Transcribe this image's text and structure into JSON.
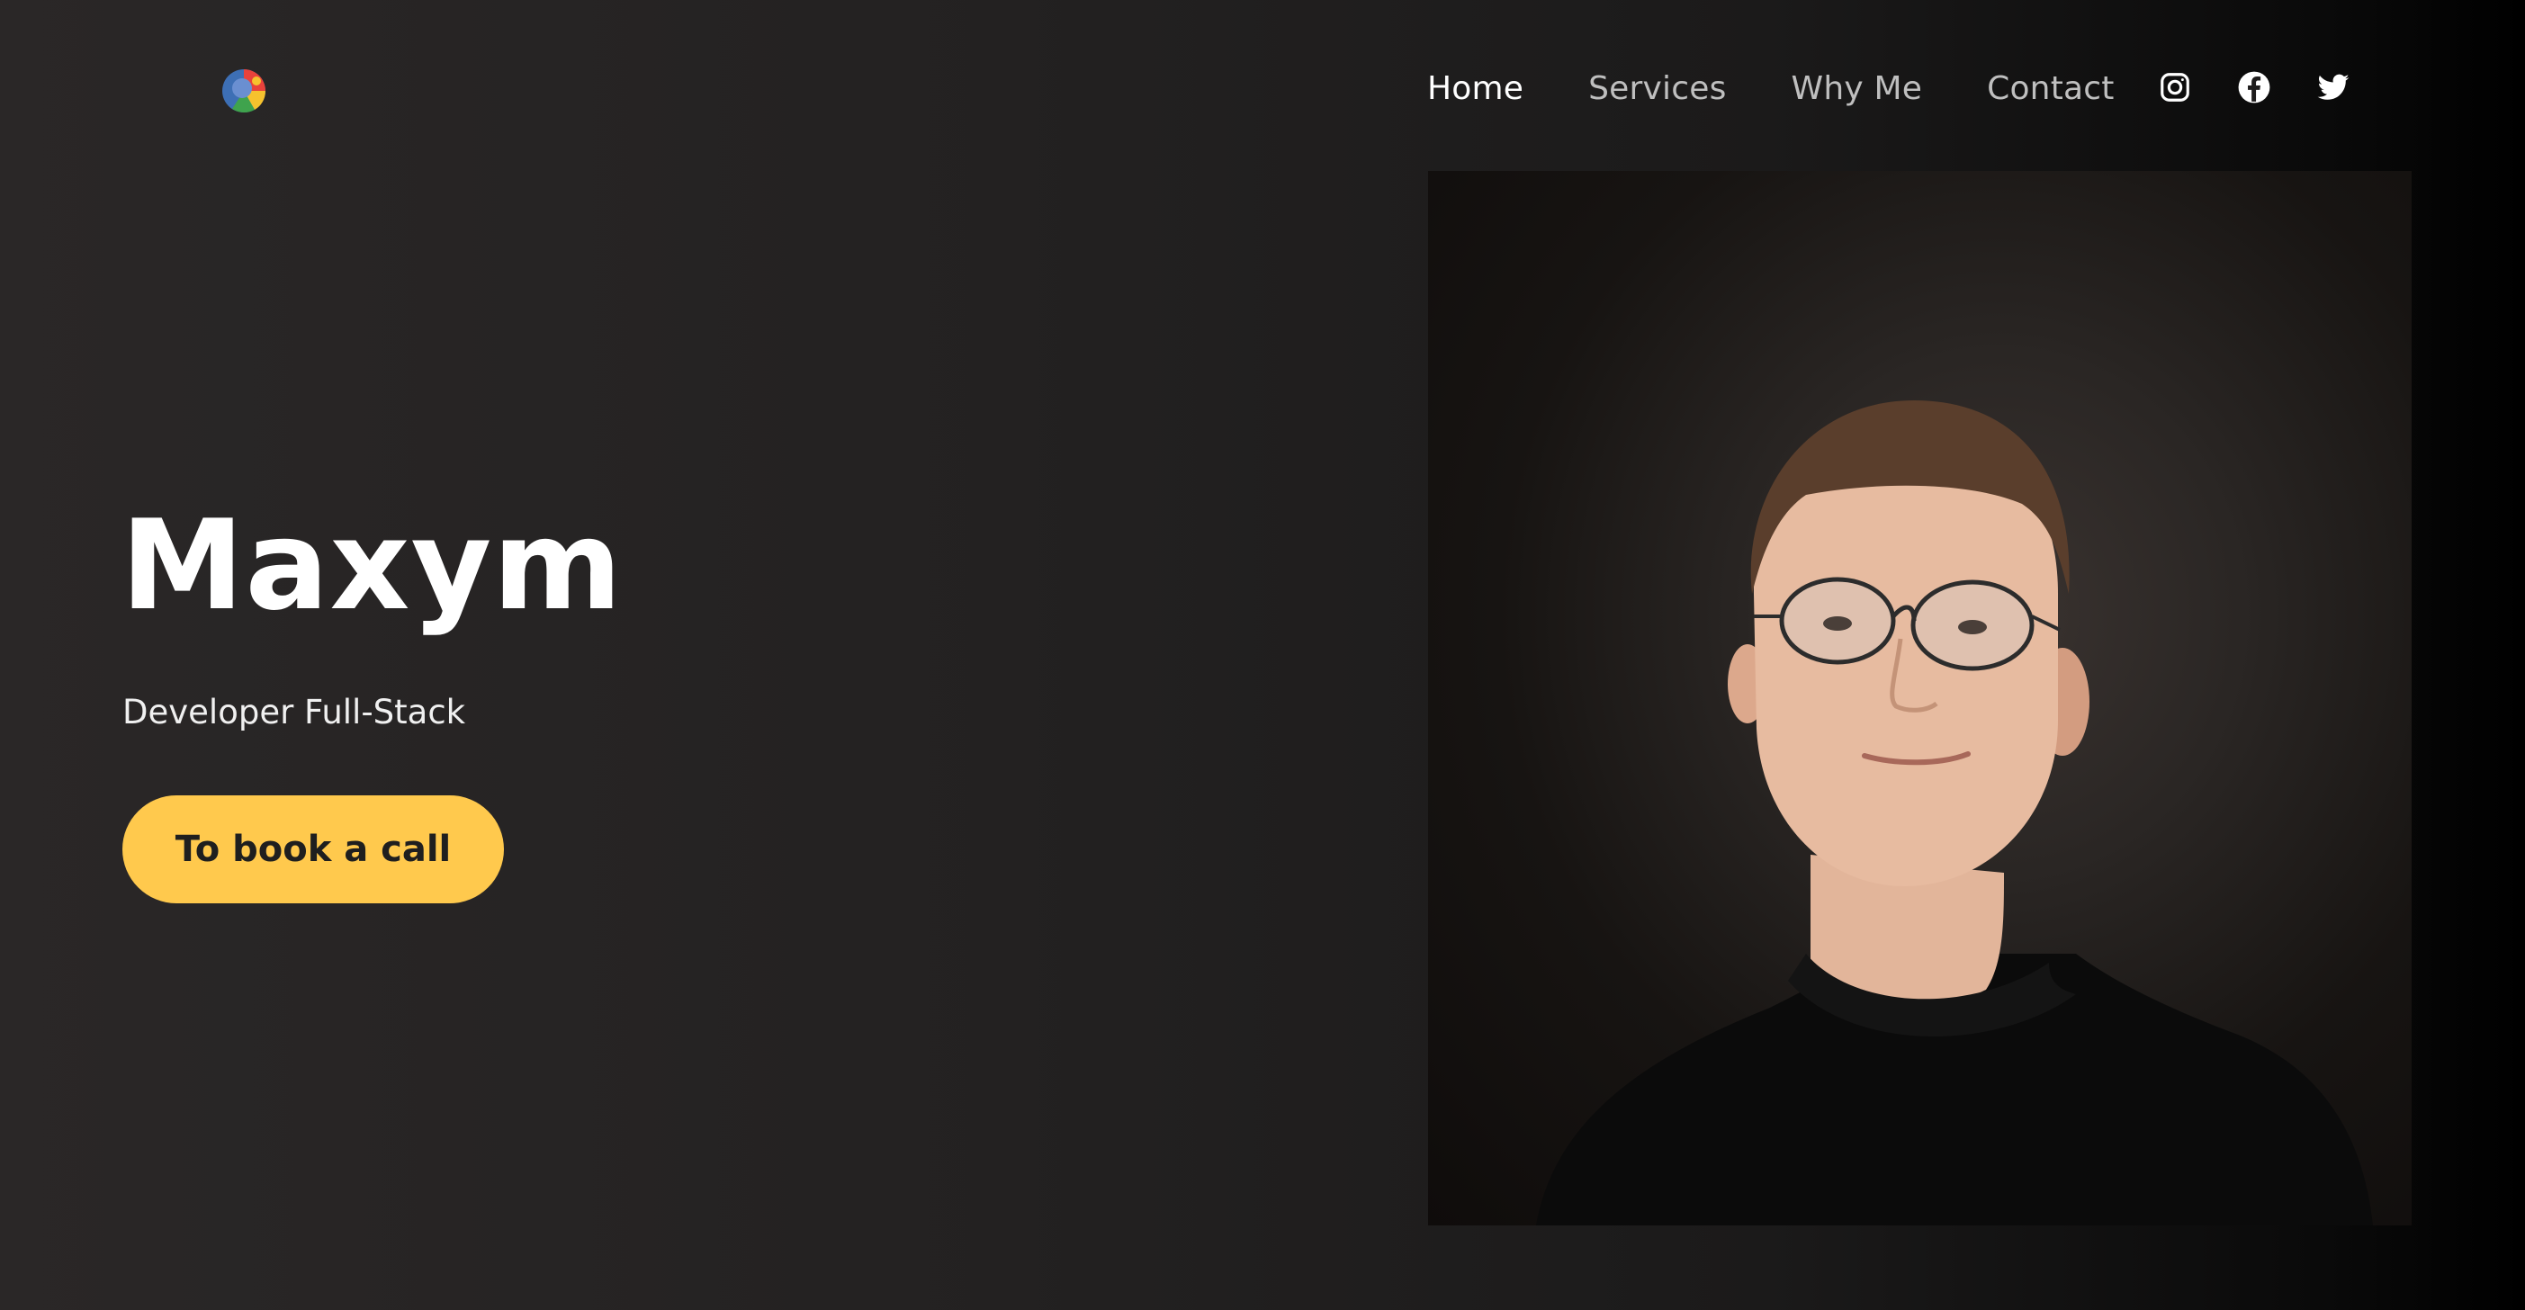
{
  "header": {
    "logo_icon": "colorful-sphere-logo",
    "nav": [
      {
        "label": "Home",
        "active": true
      },
      {
        "label": "Services",
        "active": false
      },
      {
        "label": "Why Me",
        "active": false
      },
      {
        "label": "Contact",
        "active": false
      }
    ],
    "social": [
      "instagram-icon",
      "facebook-icon",
      "twitter-icon"
    ]
  },
  "hero": {
    "name": "Maxym",
    "role": "Developer Full-Stack",
    "cta_label": "To book a call",
    "photo_subject": "portrait of man with glasses in black t-shirt"
  },
  "colors": {
    "accent": "#FFC94D",
    "background": "#232121",
    "text": "#FFFFFF",
    "nav_inactive": "#BFBFBF"
  }
}
